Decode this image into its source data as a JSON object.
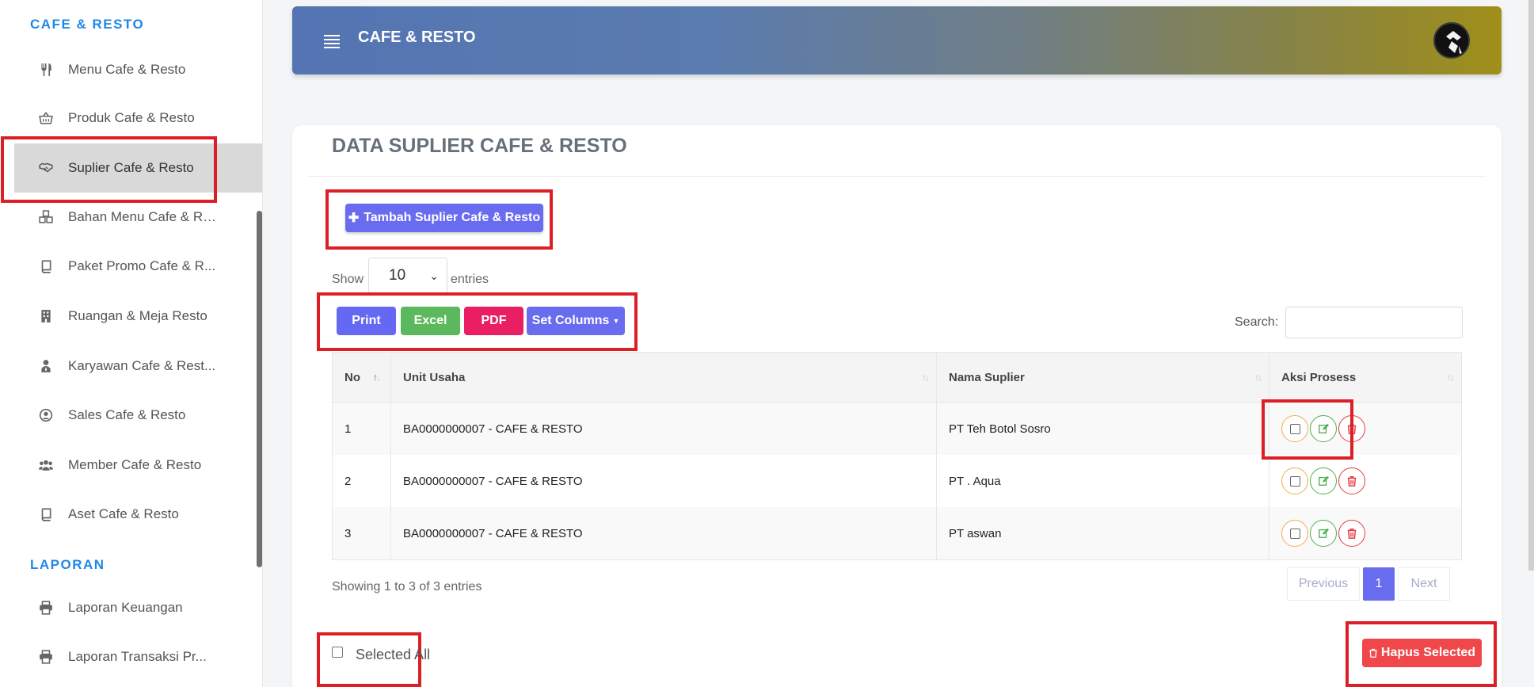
{
  "sidebar": {
    "section_main": "CAFE & RESTO",
    "section_report": "LAPORAN",
    "items": [
      {
        "label": "Menu Cafe & Resto",
        "icon": "utensils-icon"
      },
      {
        "label": "Produk Cafe & Resto",
        "icon": "basket-icon"
      },
      {
        "label": "Suplier Cafe & Resto",
        "icon": "handshake-icon",
        "active": true
      },
      {
        "label": "Bahan Menu Cafe & Re...",
        "icon": "cubes-icon"
      },
      {
        "label": "Paket Promo Cafe & R...",
        "icon": "book-icon"
      },
      {
        "label": "Ruangan & Meja Resto",
        "icon": "building-icon"
      },
      {
        "label": "Karyawan Cafe & Rest...",
        "icon": "user-tie-icon"
      },
      {
        "label": "Sales Cafe & Resto",
        "icon": "user-circle-icon"
      },
      {
        "label": "Member Cafe & Resto",
        "icon": "users-icon"
      },
      {
        "label": "Aset Cafe & Resto",
        "icon": "book-icon"
      }
    ],
    "report_items": [
      {
        "label": "Laporan Keuangan",
        "icon": "print-icon"
      },
      {
        "label": "Laporan Transaksi Pr...",
        "icon": "print-icon"
      }
    ]
  },
  "header": {
    "title": "CAFE & RESTO"
  },
  "page": {
    "title": "DATA SUPLIER CAFE & RESTO",
    "add_button": "Tambah Suplier Cafe & Resto",
    "show_label": "Show",
    "entries_value": "10",
    "entries_label": "entries",
    "export": {
      "print": "Print",
      "excel": "Excel",
      "pdf": "PDF",
      "set_columns": "Set Columns"
    },
    "search_label": "Search:",
    "search_value": ""
  },
  "table": {
    "headers": {
      "no": "No",
      "unit": "Unit Usaha",
      "supplier": "Nama Suplier",
      "actions": "Aksi Prosess"
    },
    "rows": [
      {
        "no": "1",
        "unit": "BA0000000007 - CAFE & RESTO",
        "supplier": "PT Teh Botol Sosro"
      },
      {
        "no": "2",
        "unit": "BA0000000007 - CAFE & RESTO",
        "supplier": "PT . Aqua"
      },
      {
        "no": "3",
        "unit": "BA0000000007 - CAFE & RESTO",
        "supplier": "PT aswan"
      }
    ]
  },
  "footer": {
    "info": "Showing 1 to 3 of 3 entries",
    "previous": "Previous",
    "page": "1",
    "next": "Next",
    "select_all": "Selected All",
    "delete_selected": "Hapus Selected"
  },
  "colors": {
    "accent": "#6a6cf0",
    "highlight": "#dc1f26",
    "excel": "#5cb85c",
    "pdf": "#e91e63",
    "danger": "#f0474a",
    "heading_blue": "#1e88e5"
  }
}
